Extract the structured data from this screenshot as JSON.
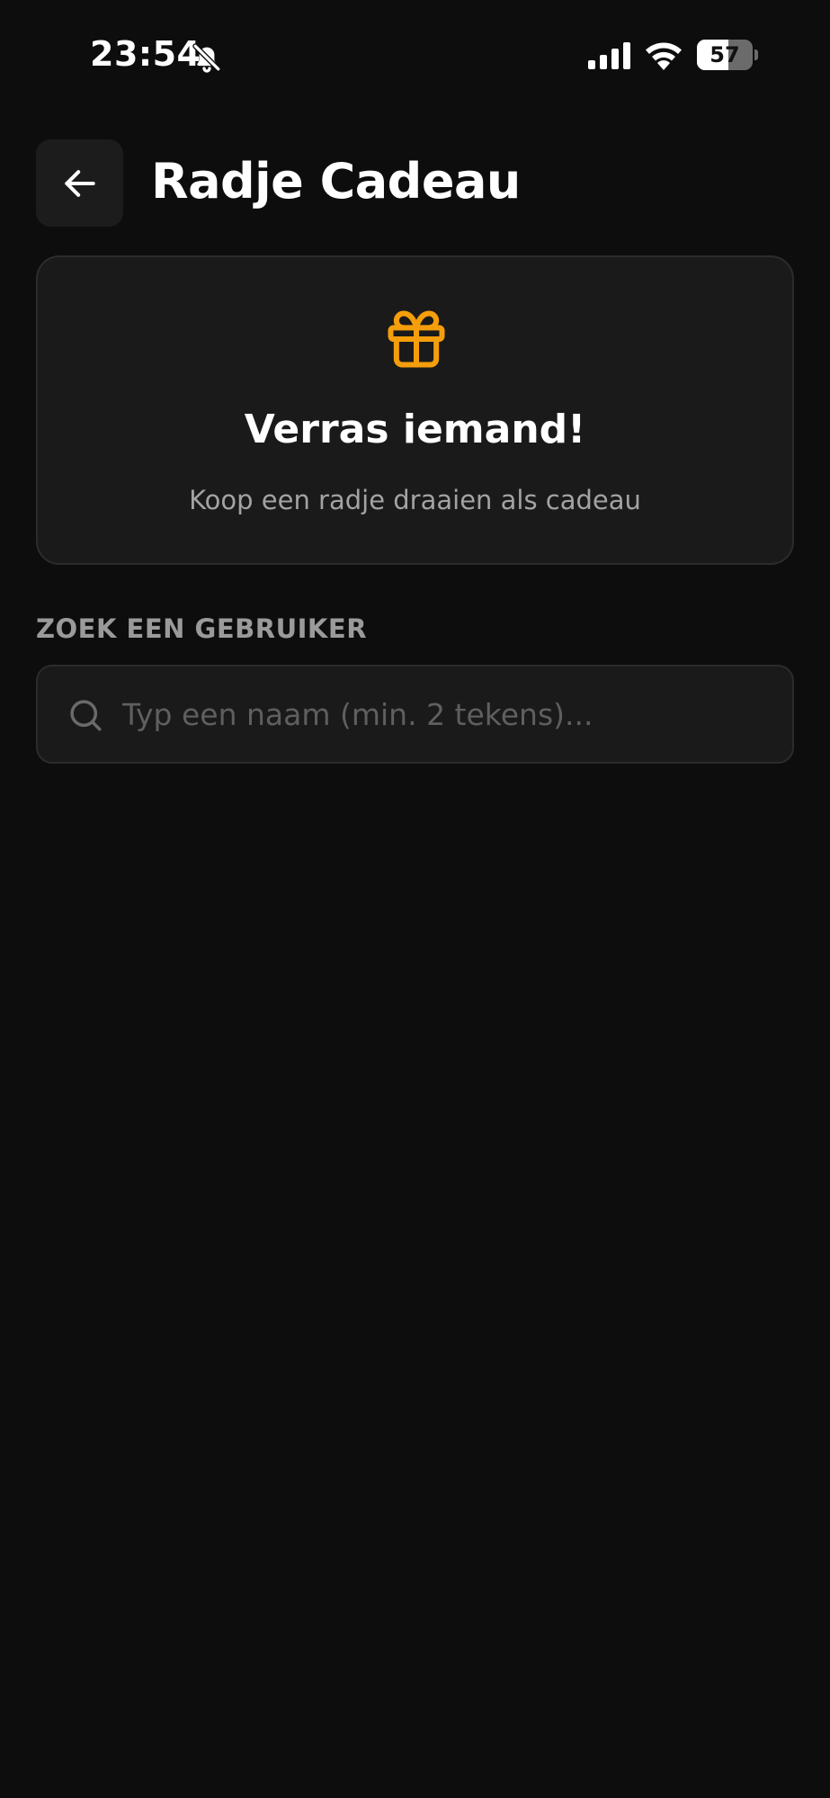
{
  "status_bar": {
    "time": "23:54",
    "battery": "57",
    "battery_level": 0.57,
    "icons": [
      "bell-slash-icon",
      "signal-icon",
      "wifi-icon",
      "battery-icon"
    ]
  },
  "header": {
    "title": "Radje Cadeau",
    "back_icon": "arrow-left-icon"
  },
  "gift_card": {
    "icon": "gift-icon",
    "title": "Verras iemand!",
    "subtitle": "Koop een radje draaien als cadeau"
  },
  "search": {
    "section_label": "ZOEK EEN GEBRUIKER",
    "placeholder": "Typ een naam (min. 2 tekens)...",
    "value": "",
    "icon": "search-icon"
  },
  "colors": {
    "background": "#0d0d0d",
    "card": "#1a1a1a",
    "accent": "#f59e0b",
    "muted_text": "#9a9a9a"
  }
}
